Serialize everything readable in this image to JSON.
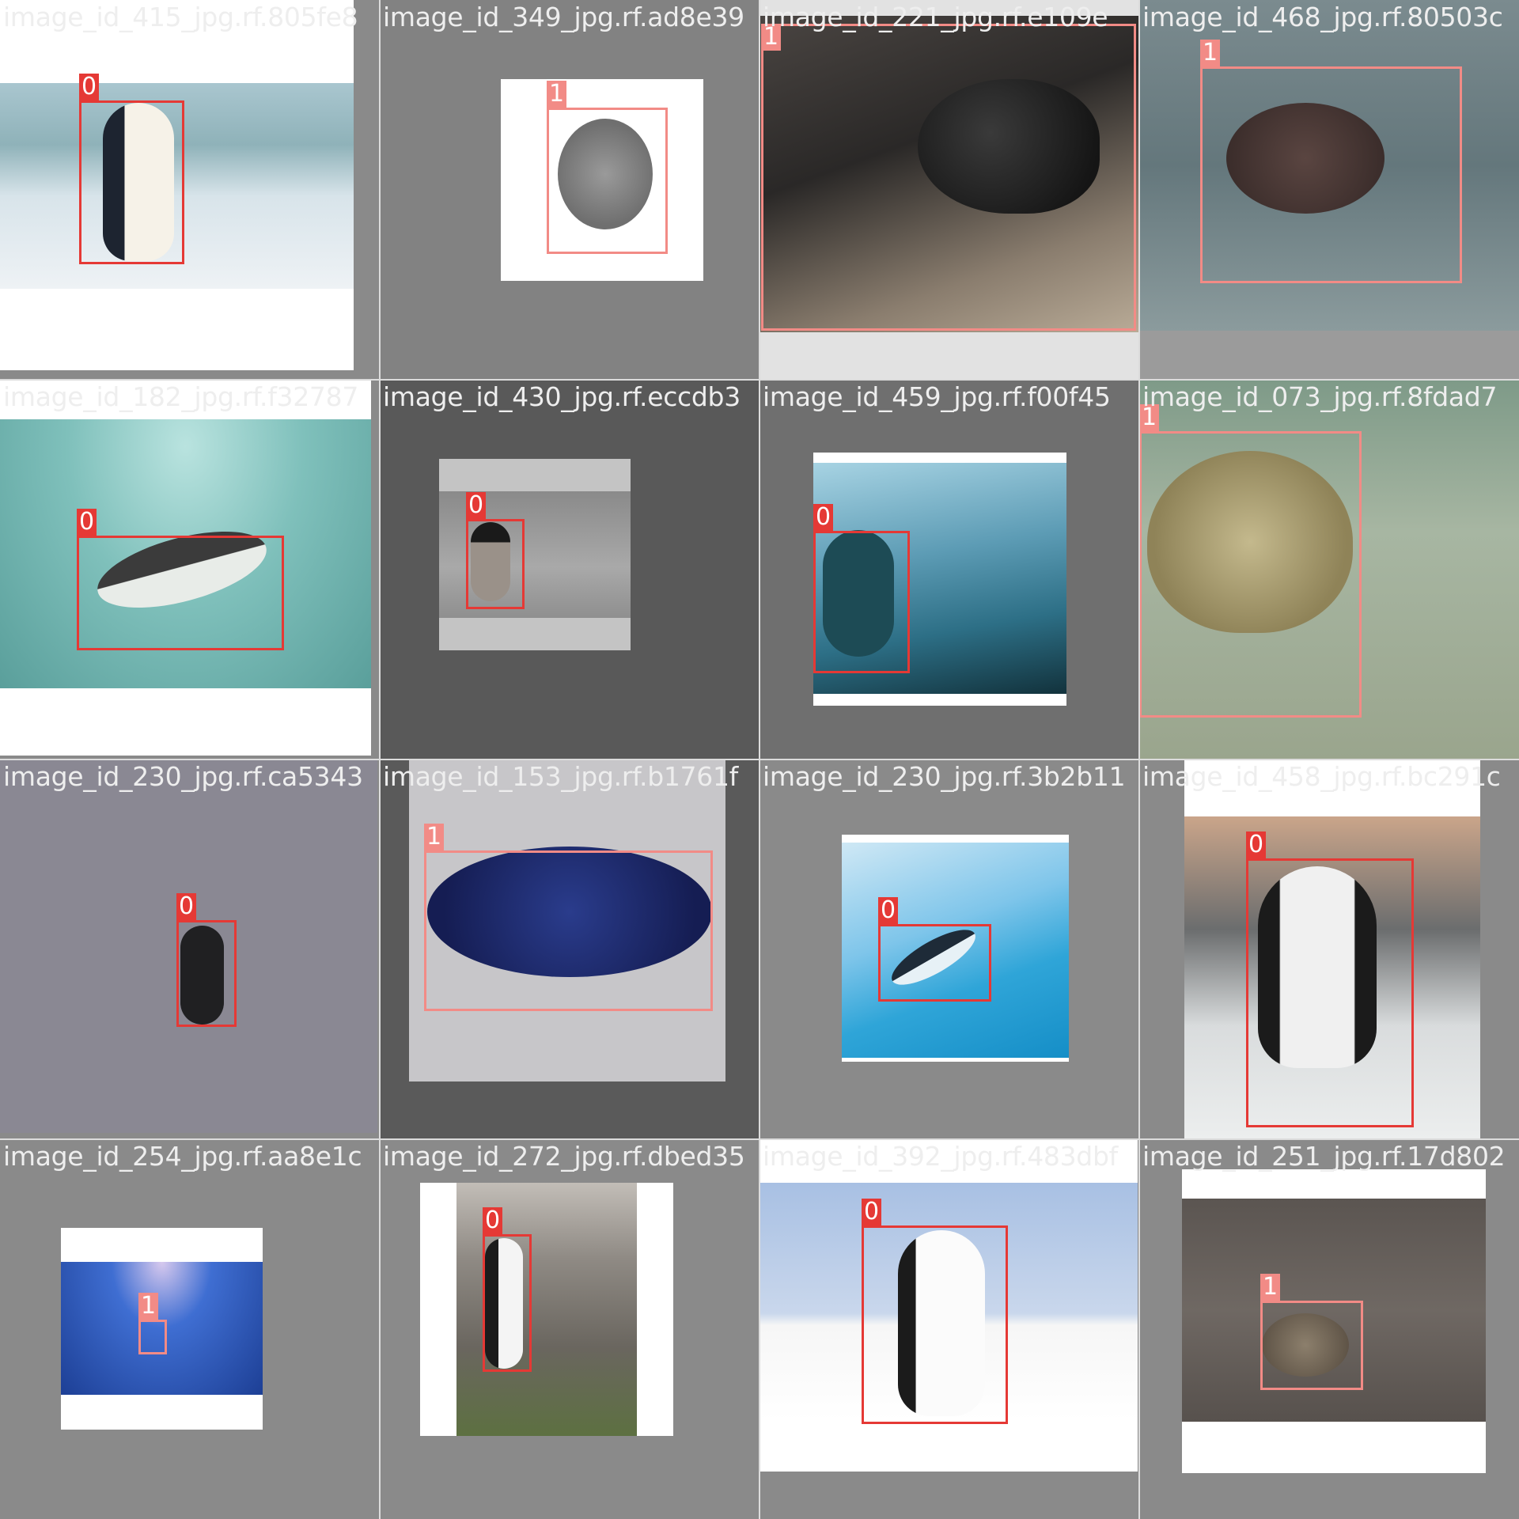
{
  "title": "",
  "class_colors": {
    "0": "#e53935",
    "1": "#f28b86"
  },
  "tiles": [
    {
      "filename": "image_id_415_jpg.rf.805fe8",
      "scene": "penguin on snow, icy cliff",
      "boxes": [
        {
          "label": "0"
        }
      ]
    },
    {
      "filename": "image_id_349_jpg.rf.ad8e39",
      "scene": "turtle figure on white",
      "boxes": [
        {
          "label": "1"
        }
      ]
    },
    {
      "filename": "image_id_221_jpg.rf.e109e",
      "scene": "leatherback hatchling close-up",
      "boxes": [
        {
          "label": "1"
        }
      ]
    },
    {
      "filename": "image_id_468_jpg.rf.80503c",
      "scene": "sea turtle swimming",
      "boxes": [
        {
          "label": "1"
        }
      ]
    },
    {
      "filename": "image_id_182_jpg.rf.f32787",
      "scene": "penguin swimming underwater",
      "boxes": [
        {
          "label": "0"
        }
      ]
    },
    {
      "filename": "image_id_430_jpg.rf.eccdb3",
      "scene": "chick on sand",
      "boxes": [
        {
          "label": "0"
        }
      ]
    },
    {
      "filename": "image_id_459_jpg.rf.f00f45",
      "scene": "penguin on wave-washed rock",
      "boxes": [
        {
          "label": "0"
        }
      ]
    },
    {
      "filename": "image_id_073_jpg.rf.8fdad7",
      "scene": "turtle in shallow water",
      "boxes": [
        {
          "label": "1"
        }
      ]
    },
    {
      "filename": "image_id_230_jpg.rf.ca5343",
      "scene": "penguin on grey background",
      "boxes": [
        {
          "label": "0"
        }
      ]
    },
    {
      "filename": "image_id_153_jpg.rf.b1761f",
      "scene": "spotted blue turtle model",
      "boxes": [
        {
          "label": "1"
        }
      ]
    },
    {
      "filename": "image_id_230_jpg.rf.3b2b11",
      "scene": "penguin diving by iceberg",
      "boxes": [
        {
          "label": "0"
        }
      ]
    },
    {
      "filename": "image_id_458_jpg.rf.bc291c",
      "scene": "african penguin on beach",
      "boxes": [
        {
          "label": "0"
        }
      ]
    },
    {
      "filename": "image_id_254_jpg.rf.aa8e1c",
      "scene": "deep blue water",
      "boxes": [
        {
          "label": "1"
        }
      ]
    },
    {
      "filename": "image_id_272_jpg.rf.dbed35",
      "scene": "king penguin colony",
      "boxes": [
        {
          "label": "0"
        }
      ]
    },
    {
      "filename": "image_id_392_jpg.rf.483dbf",
      "scene": "adelie penguin on snow",
      "boxes": [
        {
          "label": "0"
        }
      ]
    },
    {
      "filename": "image_id_251_jpg.rf.17d802",
      "scene": "tortoise on dirt",
      "boxes": [
        {
          "label": "1"
        }
      ]
    }
  ]
}
